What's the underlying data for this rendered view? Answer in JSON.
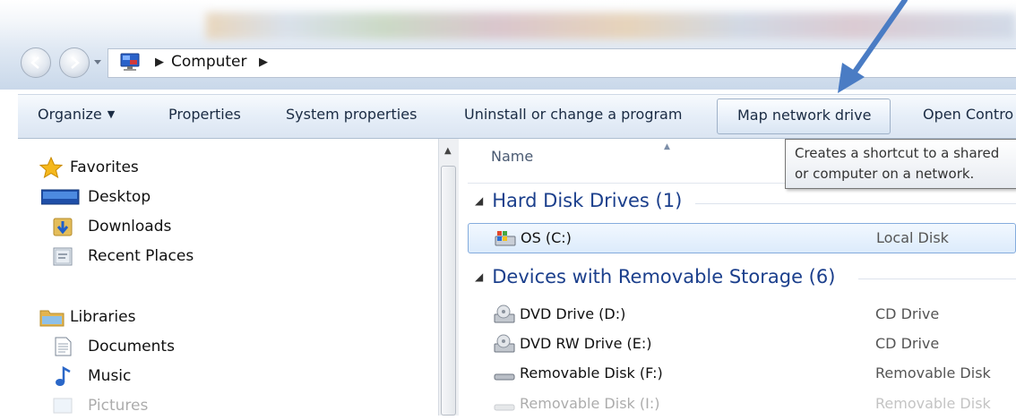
{
  "address_bar": {
    "breadcrumb": [
      "Computer"
    ]
  },
  "toolbar": {
    "organize": "Organize",
    "properties": "Properties",
    "system_properties": "System properties",
    "uninstall": "Uninstall or change a program",
    "map_network_drive": "Map network drive",
    "open_control": "Open Contro"
  },
  "tooltip": {
    "line1": "Creates a shortcut to a shared",
    "line2": "or computer on a network."
  },
  "sidebar": {
    "favorites": {
      "label": "Favorites",
      "items": [
        {
          "label": "Desktop",
          "icon": "desktop-icon"
        },
        {
          "label": "Downloads",
          "icon": "downloads-folder-icon"
        },
        {
          "label": "Recent Places",
          "icon": "recent-places-icon"
        }
      ]
    },
    "libraries": {
      "label": "Libraries",
      "items": [
        {
          "label": "Documents",
          "icon": "documents-icon"
        },
        {
          "label": "Music",
          "icon": "music-icon"
        },
        {
          "label": "Pictures",
          "icon": "pictures-icon"
        }
      ]
    }
  },
  "content": {
    "column_name": "Name",
    "groups": [
      {
        "title": "Hard Disk Drives (1)",
        "items": [
          {
            "name": "OS (C:)",
            "type": "Local Disk",
            "icon": "hard-disk-icon",
            "selected": true
          }
        ]
      },
      {
        "title": "Devices with Removable Storage (6)",
        "items": [
          {
            "name": "DVD Drive (D:)",
            "type": "CD Drive",
            "icon": "dvd-drive-icon"
          },
          {
            "name": "DVD RW Drive (E:)",
            "type": "CD Drive",
            "icon": "dvd-drive-icon"
          },
          {
            "name": "Removable Disk (F:)",
            "type": "Removable Disk",
            "icon": "removable-disk-icon"
          },
          {
            "name": "Removable Disk (I:)",
            "type": "Removable Disk",
            "icon": "removable-disk-icon"
          }
        ]
      }
    ]
  },
  "colors": {
    "group_title": "#1b3f8c",
    "annotation_arrow": "#4a7cc4",
    "selection_border": "#84acdd"
  }
}
